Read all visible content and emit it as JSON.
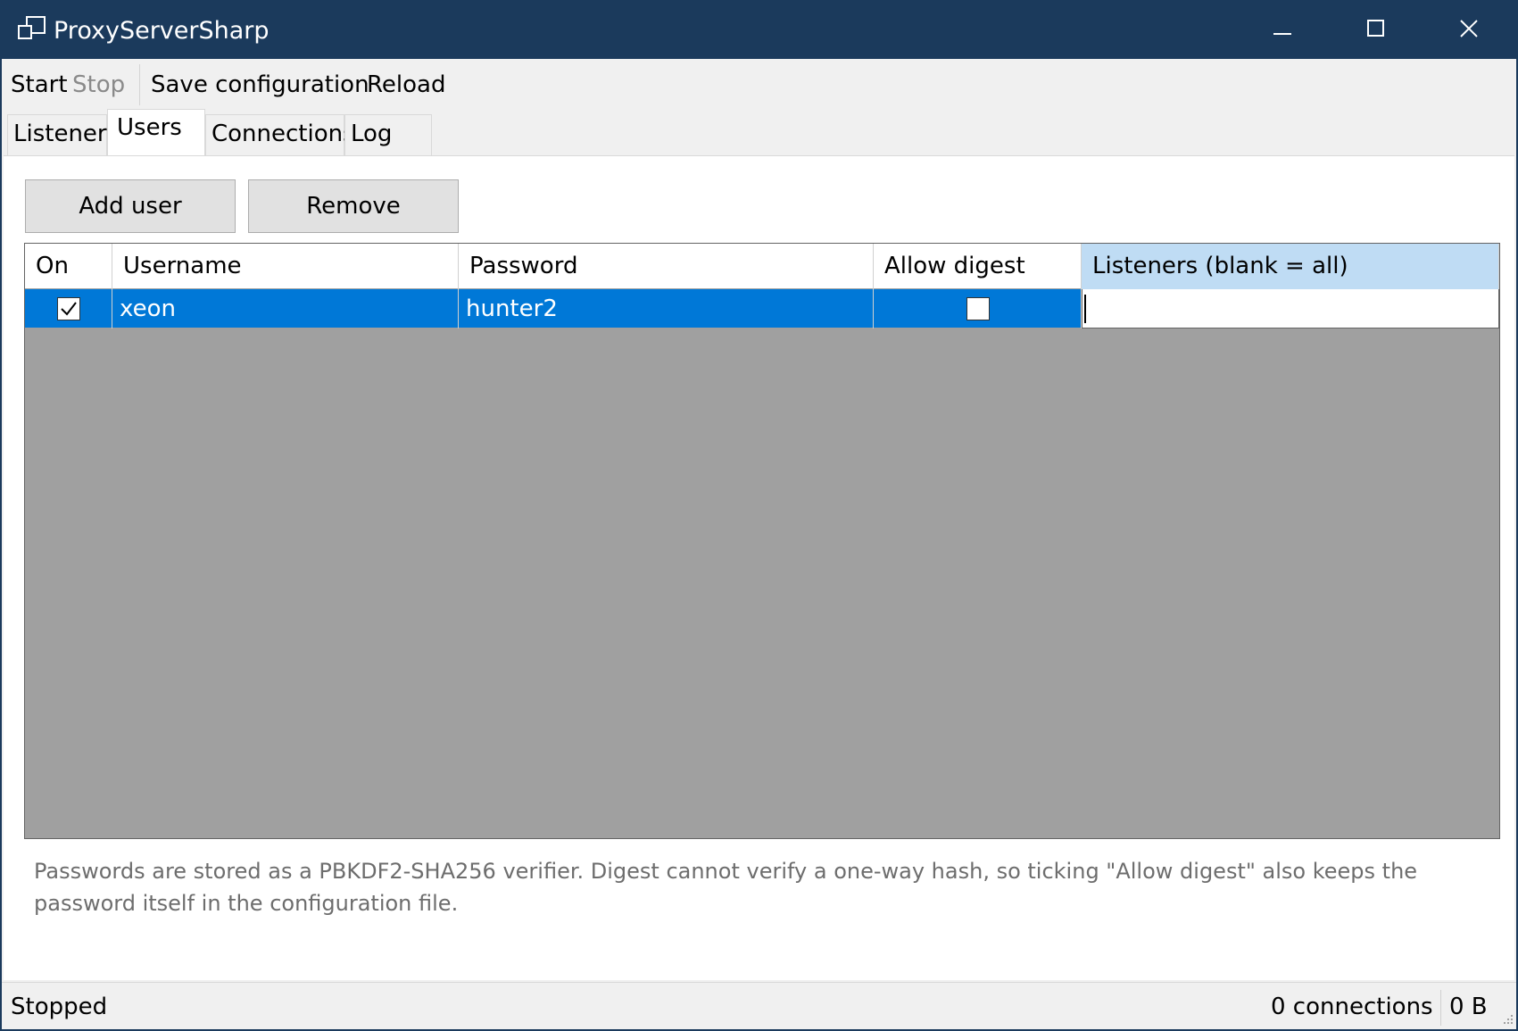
{
  "window": {
    "title": "ProxyServerSharp",
    "accent_color": "#1b3a5c",
    "icons": {
      "app": "windows-icon",
      "minimize": "minimize-icon",
      "maximize": "maximize-icon",
      "close": "close-icon"
    }
  },
  "menu": {
    "start": "Start",
    "stop": "Stop",
    "save": "Save configuration",
    "reload": "Reload"
  },
  "tabs": [
    {
      "label": "Listeners",
      "active": false
    },
    {
      "label": "Users",
      "active": true
    },
    {
      "label": "Connections",
      "active": false
    },
    {
      "label": "Log",
      "active": false
    }
  ],
  "users": {
    "add_button": "Add user",
    "remove_button": "Remove",
    "columns": [
      "On",
      "Username",
      "Password",
      "Allow digest",
      "Listeners (blank = all)"
    ],
    "rows": [
      {
        "on": true,
        "username": "xeon",
        "password": "hunter2",
        "allow_digest": false,
        "listeners": ""
      }
    ],
    "selection_color": "#0078d7",
    "note": "Passwords are stored as a PBKDF2-SHA256 verifier. Digest cannot verify a one-way hash, so ticking \"Allow digest\" also keeps the password itself in the configuration file."
  },
  "status": {
    "state": "Stopped",
    "connections": "0 connections",
    "bytes": "0 B"
  }
}
